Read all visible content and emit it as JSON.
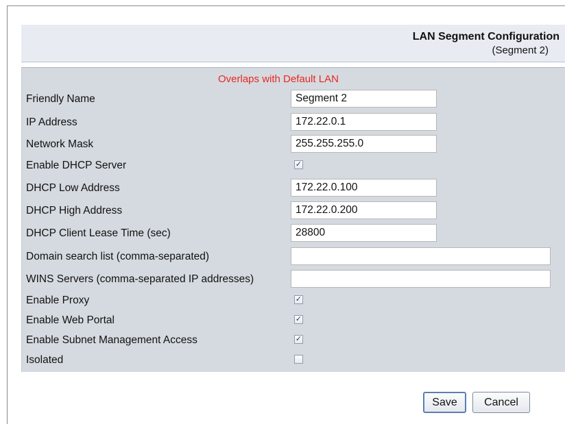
{
  "header": {
    "title": "LAN Segment Configuration",
    "subtitle": "(Segment 2)"
  },
  "warning": "Overlaps with Default LAN",
  "fields": {
    "friendly_name": {
      "label": "Friendly Name",
      "value": "Segment 2"
    },
    "ip_address": {
      "label": "IP Address",
      "value": "172.22.0.1"
    },
    "network_mask": {
      "label": "Network Mask",
      "value": "255.255.255.0"
    },
    "enable_dhcp": {
      "label": "Enable DHCP Server",
      "checked": true
    },
    "dhcp_low": {
      "label": "DHCP Low Address",
      "value": "172.22.0.100"
    },
    "dhcp_high": {
      "label": "DHCP High Address",
      "value": "172.22.0.200"
    },
    "lease_time": {
      "label": "DHCP Client Lease Time (sec)",
      "value": "28800"
    },
    "domain_search": {
      "label": "Domain search list (comma-separated)",
      "value": ""
    },
    "wins_servers": {
      "label": "WINS Servers (comma-separated IP addresses)",
      "value": ""
    },
    "enable_proxy": {
      "label": "Enable Proxy",
      "checked": true
    },
    "enable_web_portal": {
      "label": "Enable Web Portal",
      "checked": true
    },
    "enable_subnet_mgmt": {
      "label": "Enable Subnet Management Access",
      "checked": true
    },
    "isolated": {
      "label": "Isolated",
      "checked": false
    }
  },
  "buttons": {
    "save": "Save",
    "cancel": "Cancel"
  },
  "check_glyph": "✓"
}
